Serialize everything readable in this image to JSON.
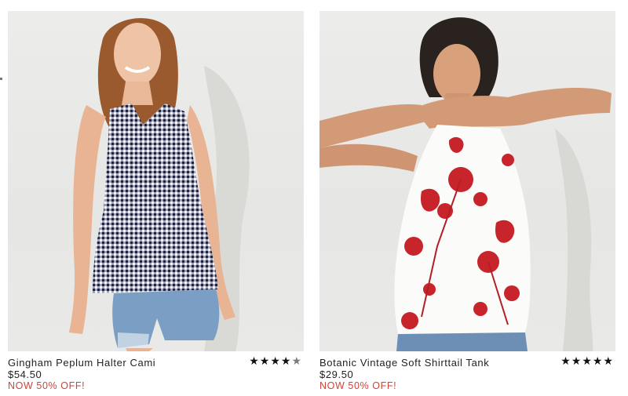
{
  "products": [
    {
      "name": "Gingham Peplum Halter Cami",
      "price": "$54.50",
      "promo": "NOW 50% OFF!",
      "rating": 4.5,
      "stars_full": "★★★★",
      "stars_half": "★",
      "image_icon": "model-photo-gingham-top"
    },
    {
      "name": "Botanic Vintage Soft Shirttail Tank",
      "price": "$29.50",
      "promo": "NOW 50% OFF!",
      "rating": 5,
      "stars_full": "★★★★★",
      "stars_half": "",
      "image_icon": "model-photo-floral-tank"
    }
  ],
  "colors": {
    "promo": "#d0423a",
    "text": "#222222",
    "photo_bg": "#e8e8e6"
  }
}
